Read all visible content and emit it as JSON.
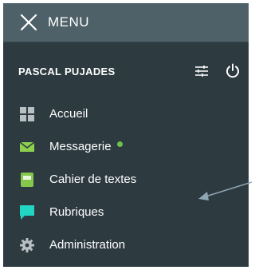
{
  "menu": {
    "label": "MENU"
  },
  "user": {
    "name": "PASCAL PUJADES"
  },
  "nav": {
    "items": [
      {
        "label": "Accueil",
        "icon": "grid-icon"
      },
      {
        "label": "Messagerie",
        "icon": "envelope-icon",
        "notification": true
      },
      {
        "label": "Cahier de textes",
        "icon": "notebook-icon"
      },
      {
        "label": "Rubriques",
        "icon": "chat-bubble-icon"
      },
      {
        "label": "Administration",
        "icon": "gear-icon"
      }
    ]
  },
  "colors": {
    "header_bg": "#4e6068",
    "panel_bg": "#2d3a40",
    "notification_dot": "#6cc24a",
    "envelope": "#8fd14f",
    "notebook": "#86c84b",
    "chat": "#21d6c3",
    "gear": "#b8c0c4",
    "grid": "#b8c0c4"
  }
}
